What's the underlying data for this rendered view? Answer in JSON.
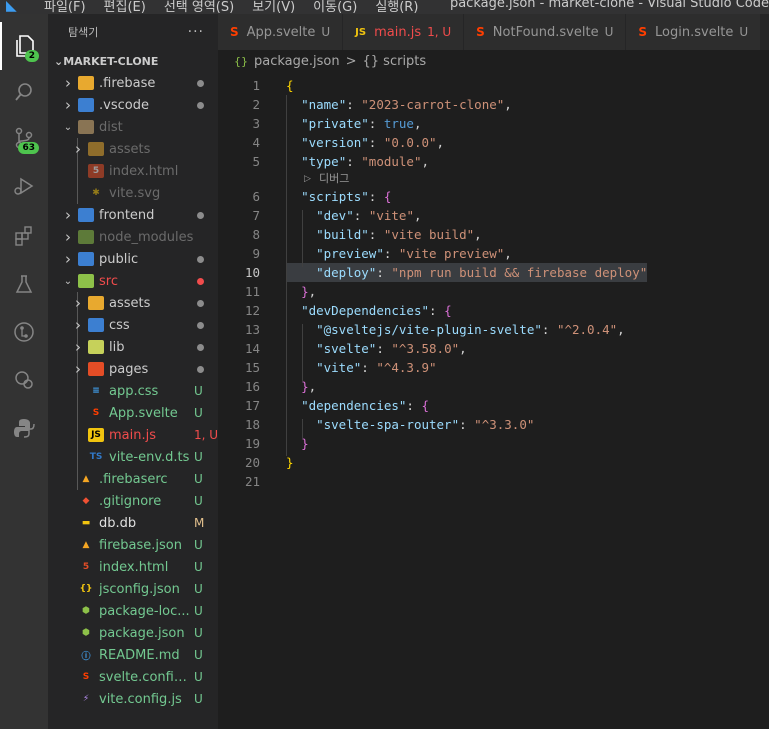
{
  "titlebar": {
    "menus": [
      "파일(F)",
      "편집(E)",
      "선택 영역(S)",
      "보기(V)",
      "이동(G)",
      "실행(R)"
    ],
    "window_title": "package.json - market-clone - Visual Studio Code"
  },
  "activity": {
    "explorer_badge": "2",
    "scm_badge": "63"
  },
  "sidebar": {
    "title": "탐색기",
    "more": "···",
    "project": "MARKET-CLONE",
    "items": [
      {
        "name": ".firebase",
        "status": "",
        "dot": true,
        "dim": false
      },
      {
        "name": ".vscode",
        "status": "",
        "dot": true,
        "dim": false
      },
      {
        "name": "dist",
        "status": "",
        "dot": false,
        "dim": true
      },
      {
        "name": "assets",
        "status": "",
        "dot": false,
        "dim": true
      },
      {
        "name": "index.html",
        "status": "",
        "dot": false,
        "dim": true
      },
      {
        "name": "vite.svg",
        "status": "",
        "dot": false,
        "dim": true
      },
      {
        "name": "frontend",
        "status": "",
        "dot": true,
        "dim": false
      },
      {
        "name": "node_modules",
        "status": "",
        "dot": false,
        "dim": true
      },
      {
        "name": "public",
        "status": "",
        "dot": true,
        "dim": false
      },
      {
        "name": "src",
        "status": "",
        "dot": true,
        "dim": false
      },
      {
        "name": "assets",
        "status": "",
        "dot": true,
        "dim": false
      },
      {
        "name": "css",
        "status": "",
        "dot": true,
        "dim": false
      },
      {
        "name": "lib",
        "status": "",
        "dot": true,
        "dim": false
      },
      {
        "name": "pages",
        "status": "",
        "dot": true,
        "dim": false
      },
      {
        "name": "app.css",
        "status": "U",
        "dot": false,
        "dim": false
      },
      {
        "name": "App.svelte",
        "status": "U",
        "dot": false,
        "dim": false
      },
      {
        "name": "main.js",
        "status": "1, U",
        "dot": false,
        "dim": false
      },
      {
        "name": "vite-env.d.ts",
        "status": "U",
        "dot": false,
        "dim": false
      },
      {
        "name": ".firebaserc",
        "status": "U",
        "dot": false,
        "dim": false
      },
      {
        "name": ".gitignore",
        "status": "U",
        "dot": false,
        "dim": false
      },
      {
        "name": "db.db",
        "status": "M",
        "dot": false,
        "dim": false
      },
      {
        "name": "firebase.json",
        "status": "U",
        "dot": false,
        "dim": false
      },
      {
        "name": "index.html",
        "status": "U",
        "dot": false,
        "dim": false
      },
      {
        "name": "jsconfig.json",
        "status": "U",
        "dot": false,
        "dim": false
      },
      {
        "name": "package-loc...",
        "status": "U",
        "dot": false,
        "dim": false
      },
      {
        "name": "package.json",
        "status": "U",
        "dot": false,
        "dim": false
      },
      {
        "name": "README.md",
        "status": "U",
        "dot": false,
        "dim": false
      },
      {
        "name": "svelte.config.js",
        "status": "U",
        "dot": false,
        "dim": false
      },
      {
        "name": "vite.config.js",
        "status": "U",
        "dot": false,
        "dim": false
      }
    ]
  },
  "tabs": [
    {
      "label": "App.svelte",
      "mark": "U",
      "icon": "svelte-icon"
    },
    {
      "label": "main.js",
      "mark": "1, U",
      "icon": "js-icon"
    },
    {
      "label": "NotFound.svelte",
      "mark": "U",
      "icon": "svelte-icon"
    },
    {
      "label": "Login.svelte",
      "mark": "U",
      "icon": "svelte-icon"
    }
  ],
  "breadcrumb": {
    "file": "package.json",
    "sep": ">",
    "symbol": "{} scripts"
  },
  "codelens": "디버그",
  "code": {
    "line_numbers": [
      "1",
      "2",
      "3",
      "4",
      "5",
      "6",
      "7",
      "8",
      "9",
      "10",
      "11",
      "12",
      "13",
      "14",
      "15",
      "16",
      "17",
      "18",
      "19",
      "20",
      "21"
    ],
    "lines": [
      "{",
      "  \"name\": \"2023-carrot-clone\",",
      "  \"private\": true,",
      "  \"version\": \"0.0.0\",",
      "  \"type\": \"module\",",
      "  \"scripts\": {",
      "    \"dev\": \"vite\",",
      "    \"build\": \"vite build\",",
      "    \"preview\": \"vite preview\",",
      "    \"deploy\": \"npm run build && firebase deploy\"",
      "  },",
      "  \"devDependencies\": {",
      "    \"@sveltejs/vite-plugin-svelte\": \"^2.0.4\",",
      "    \"svelte\": \"^3.58.0\",",
      "    \"vite\": \"^4.3.9\"",
      "  },",
      "  \"dependencies\": {",
      "    \"svelte-spa-router\": \"^3.3.0\"",
      "  }",
      "}",
      ""
    ],
    "current_line": "10"
  },
  "colors": {
    "accent": "#007acc",
    "svelte": "#ff3e00",
    "js": "#f1c40f",
    "untracked": "#73c991",
    "error": "#f14c4c",
    "modified": "#e2c08d"
  }
}
